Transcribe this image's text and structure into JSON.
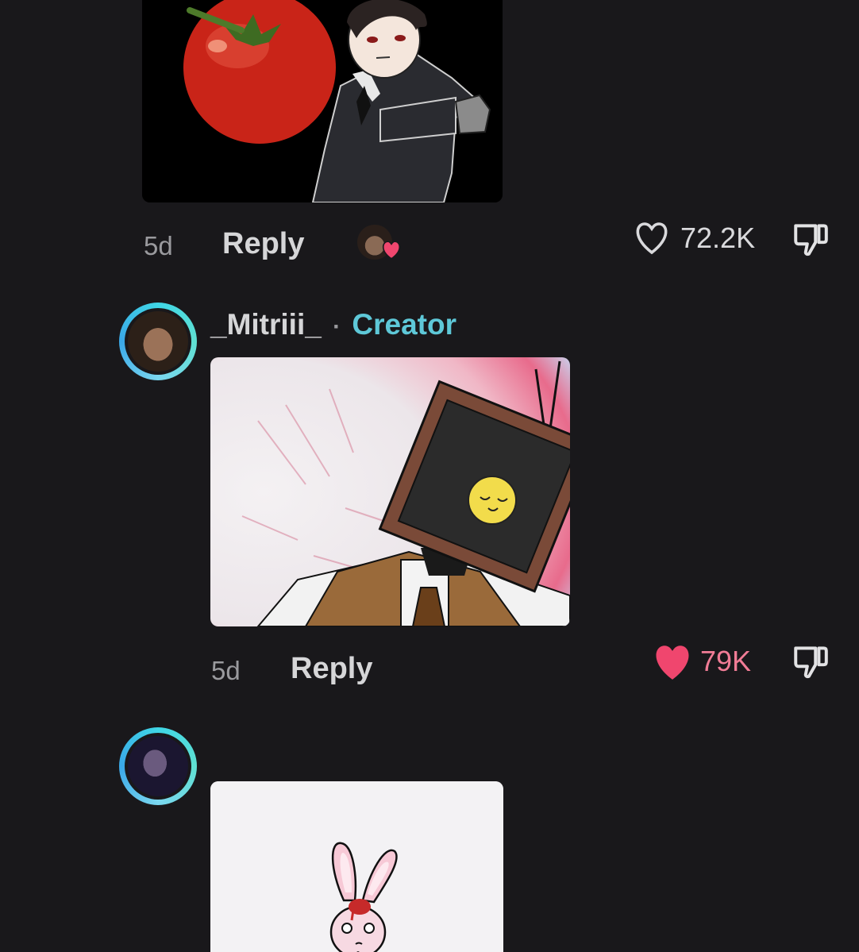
{
  "comment1": {
    "time": "5d",
    "reply_label": "Reply",
    "likes": "72.2K",
    "liked": false
  },
  "comment2": {
    "username": "_Mitriii_",
    "separator": "·",
    "creator_badge": "Creator",
    "time": "5d",
    "reply_label": "Reply",
    "likes": "79K",
    "liked": true
  },
  "comment3": {},
  "colors": {
    "background": "#19181b",
    "creator_accent": "#5ec8d8",
    "like_active": "#f0466e",
    "muted_text": "#9a9a9e"
  },
  "icons": {
    "like": "heart-outline-icon",
    "like_active": "heart-filled-icon",
    "dislike": "thumbs-down-icon"
  }
}
